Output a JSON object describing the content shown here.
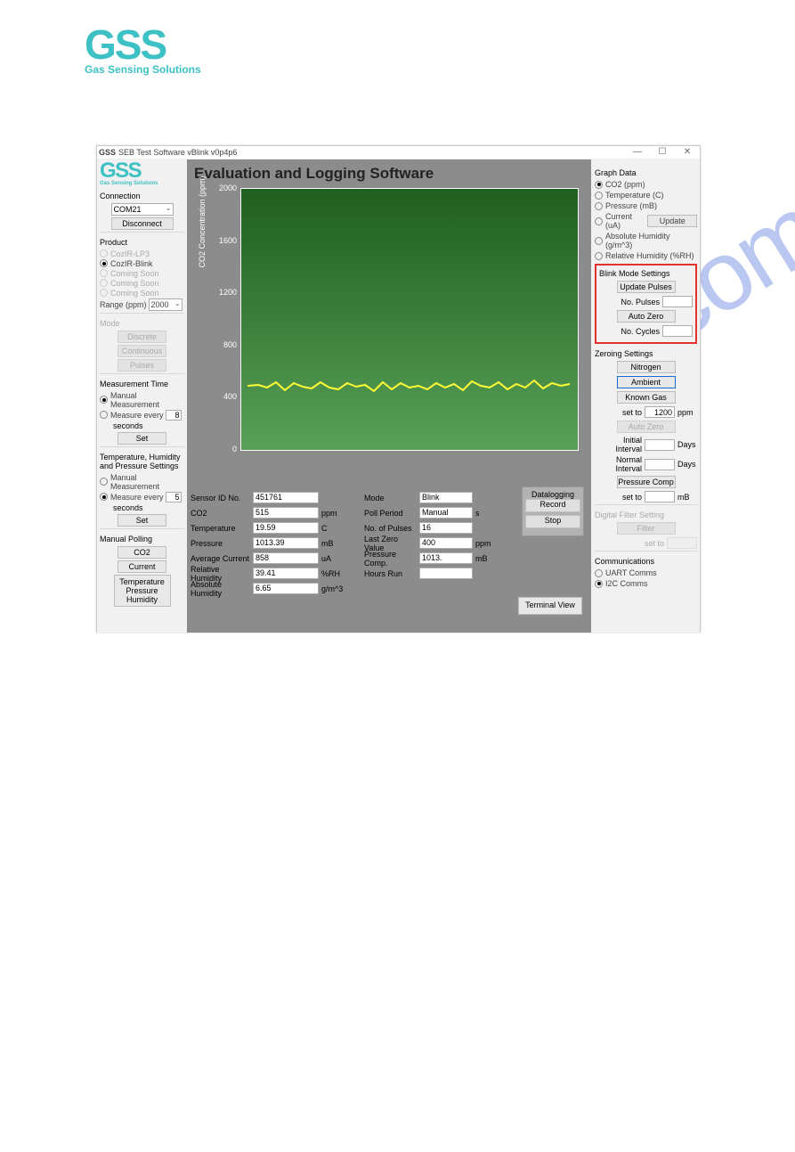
{
  "page_logo": {
    "line1": "GSS",
    "line2": "Gas Sensing Solutions"
  },
  "window": {
    "title": "SEB Test Software vBlink v0p4p6"
  },
  "app_title": "Evaluation and Logging Software",
  "left": {
    "connection": {
      "label": "Connection",
      "port": "COM21",
      "disconnect": "Disconnect"
    },
    "product": {
      "label": "Product",
      "items": [
        {
          "label": "CozIR-LP3",
          "checked": false,
          "disabled": true
        },
        {
          "label": "CozIR-Blink",
          "checked": true,
          "disabled": false
        },
        {
          "label": "Coming Soon",
          "checked": false,
          "disabled": true
        },
        {
          "label": "Coming Soon",
          "checked": false,
          "disabled": true
        },
        {
          "label": "Coming Soon",
          "checked": false,
          "disabled": true
        }
      ],
      "range_label": "Range (ppm)",
      "range_value": "2000"
    },
    "mode": {
      "label": "Mode",
      "buttons": [
        "Discrete",
        "Continuous",
        "Pulses"
      ]
    },
    "meas_time": {
      "label": "Measurement Time",
      "manual": "Manual Measurement",
      "manual_on": true,
      "every": "Measure every",
      "every_on": false,
      "every_val": "8",
      "every_unit": "seconds",
      "set": "Set"
    },
    "thp": {
      "label": "Temperature, Humidity and Pressure Settings",
      "manual": "Manual Measurement",
      "manual_on": false,
      "every": "Measure every",
      "every_on": true,
      "every_val": "5",
      "every_unit": "seconds",
      "set": "Set"
    },
    "manual_polling": {
      "label": "Manual Polling",
      "co2": "CO2",
      "current": "Current",
      "thp": "Temperature Pressure Humidity"
    }
  },
  "fields": {
    "col1": [
      {
        "label": "Sensor ID No.",
        "value": "451761",
        "unit": ""
      },
      {
        "label": "CO2",
        "value": "515",
        "unit": "ppm"
      },
      {
        "label": "Temperature",
        "value": "19.59",
        "unit": "C"
      },
      {
        "label": "Pressure",
        "value": "1013.39",
        "unit": "mB"
      },
      {
        "label": "Average Current",
        "value": "858",
        "unit": "uA"
      },
      {
        "label": "Relative Humidity",
        "value": "39.41",
        "unit": "%RH"
      },
      {
        "label": "Absolute Humidity",
        "value": "6.65",
        "unit": "g/m^3"
      }
    ],
    "col2": [
      {
        "label": "Mode",
        "value": "Blink",
        "unit": ""
      },
      {
        "label": "Poll Period",
        "value": "Manual",
        "unit": "s"
      },
      {
        "label": "No. of Pulses",
        "value": "16",
        "unit": ""
      },
      {
        "label": "Last Zero Value",
        "value": "400",
        "unit": "ppm"
      },
      {
        "label": "Pressure Comp.",
        "value": "1013.",
        "unit": "mB"
      },
      {
        "label": "Hours Run",
        "value": "",
        "unit": ""
      }
    ]
  },
  "datalogging": {
    "label": "Datalogging",
    "record": "Record",
    "stop": "Stop"
  },
  "terminal": "Terminal View",
  "right": {
    "graph": {
      "label": "Graph Data",
      "items": [
        {
          "label": "CO2 (ppm)",
          "on": true
        },
        {
          "label": "Temperature (C)",
          "on": false
        },
        {
          "label": "Pressure (mB)",
          "on": false
        },
        {
          "label": "Current (uA)",
          "on": false
        },
        {
          "label": "Absolute Humidity (g/m^3)",
          "on": false
        },
        {
          "label": "Relative Humidity (%RH)",
          "on": false
        }
      ],
      "update": "Update"
    },
    "blink": {
      "label": "Blink Mode Settings",
      "update_pulses": "Update Pulses",
      "pulses": "No. Pulses",
      "pulses_val": "",
      "auto_zero": "Auto Zero",
      "cycles": "No. Cycles",
      "cycles_val": ""
    },
    "zero": {
      "label": "Zeroing Settings",
      "nitrogen": "Nitrogen",
      "ambient": "Ambient",
      "known": "Known Gas",
      "set_to": "set to",
      "set_val": "1200",
      "set_unit": "ppm",
      "auto_zero": "Auto Zero",
      "initial": "Initial Interval",
      "initial_val": "",
      "days": "Days",
      "normal": "Normal Interval",
      "normal_val": "",
      "pcomp": "Pressure Comp",
      "pc_set": "set to",
      "pc_val": "",
      "pc_unit": "mB"
    },
    "filter": {
      "label": "Digital Filter Setting",
      "filter": "Filter",
      "set_to": "set to",
      "val": ""
    },
    "comms": {
      "label": "Communications",
      "uart": "UART Comms",
      "uart_on": false,
      "i2c": "I2C Comms",
      "i2c_on": true
    }
  },
  "chart_data": {
    "type": "line",
    "ylabel": "CO2 Concentration (ppm)",
    "ylim": [
      0,
      2000
    ],
    "yticks": [
      0,
      400,
      800,
      1200,
      1600,
      2000
    ],
    "series": [
      {
        "name": "CO2",
        "approx_value": 500
      }
    ]
  },
  "watermark": "manualshive.com"
}
